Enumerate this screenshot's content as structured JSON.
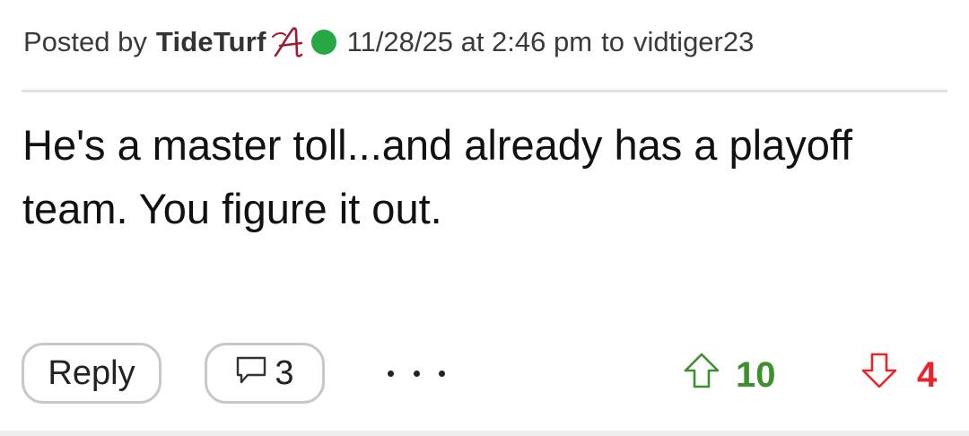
{
  "post": {
    "posted_by_label": "Posted by",
    "username": "TideTurf",
    "team_logo": "alabama-script-a-icon",
    "online_status": "online",
    "timestamp": "11/28/25 at 2:46 pm",
    "reply_to_label": "to",
    "reply_to_user": "vidtiger23",
    "body": "He's a master toll...and already has a playoff team. You figure it out."
  },
  "actions": {
    "reply_label": "Reply",
    "comment_count": "3",
    "more_icon": "more-horizontal-icon",
    "upvote_count": "10",
    "downvote_count": "4"
  },
  "colors": {
    "online": "#27a844",
    "upvote": "#3e8f2e",
    "downvote": "#e8262a",
    "logo": "#9e1b32"
  }
}
